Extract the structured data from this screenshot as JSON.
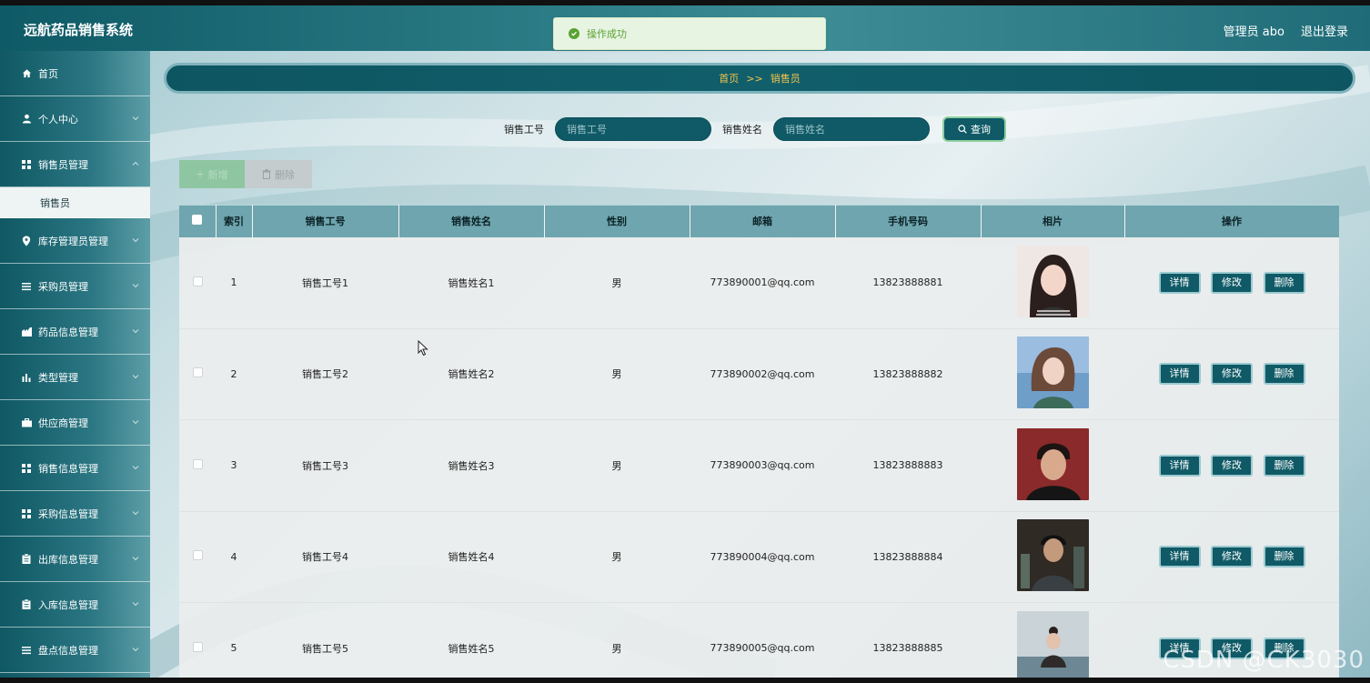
{
  "header": {
    "brand": "远航药品销售系统",
    "user_label": "管理员 abo",
    "logout_label": "退出登录"
  },
  "toast": {
    "message": "操作成功",
    "color": "#5aa234"
  },
  "sidebar": {
    "items": [
      {
        "label": "首页",
        "icon": "home-icon"
      },
      {
        "label": "个人中心",
        "icon": "user-icon"
      },
      {
        "label": "销售员管理",
        "icon": "grid-icon"
      },
      {
        "label": "库存管理员管理",
        "icon": "location-icon"
      },
      {
        "label": "采购员管理",
        "icon": "list-icon"
      },
      {
        "label": "药品信息管理",
        "icon": "building-icon"
      },
      {
        "label": "类型管理",
        "icon": "bar-chart-icon"
      },
      {
        "label": "供应商管理",
        "icon": "briefcase-icon"
      },
      {
        "label": "销售信息管理",
        "icon": "grid-icon"
      },
      {
        "label": "采购信息管理",
        "icon": "grid-icon"
      },
      {
        "label": "出库信息管理",
        "icon": "clipboard-icon"
      },
      {
        "label": "入库信息管理",
        "icon": "clipboard-icon"
      },
      {
        "label": "盘点信息管理",
        "icon": "list-icon"
      }
    ],
    "active_sub": "销售员"
  },
  "breadcrumb": {
    "home": "首页",
    "separator": ">>",
    "current": "销售员"
  },
  "search": {
    "field1_label": "销售工号",
    "field1_placeholder": "销售工号",
    "field2_label": "销售姓名",
    "field2_placeholder": "销售姓名",
    "query_label": "查询"
  },
  "actions": {
    "add_label": "新增",
    "delete_label": "删除"
  },
  "table": {
    "columns": [
      "索引",
      "销售工号",
      "销售姓名",
      "性别",
      "邮箱",
      "手机号码",
      "相片",
      "操作"
    ],
    "rows": [
      {
        "index": "1",
        "id": "销售工号1",
        "name": "销售姓名1",
        "gender": "男",
        "email": "773890001@qq.com",
        "phone": "13823888881"
      },
      {
        "index": "2",
        "id": "销售工号2",
        "name": "销售姓名2",
        "gender": "男",
        "email": "773890002@qq.com",
        "phone": "13823888882"
      },
      {
        "index": "3",
        "id": "销售工号3",
        "name": "销售姓名3",
        "gender": "男",
        "email": "773890003@qq.com",
        "phone": "13823888883"
      },
      {
        "index": "4",
        "id": "销售工号4",
        "name": "销售姓名4",
        "gender": "男",
        "email": "773890004@qq.com",
        "phone": "13823888884"
      },
      {
        "index": "5",
        "id": "销售工号5",
        "name": "销售姓名5",
        "gender": "男",
        "email": "773890005@qq.com",
        "phone": "13823888885"
      }
    ],
    "op_labels": {
      "detail": "详情",
      "edit": "修改",
      "delete": "删除"
    }
  },
  "watermark": "CSDN @CK3030",
  "colors": {
    "primary": "#0f5a66",
    "header_bg": "#6ea5ae",
    "breadcrumb_text": "#f0c44a",
    "success": "#5aa234"
  }
}
